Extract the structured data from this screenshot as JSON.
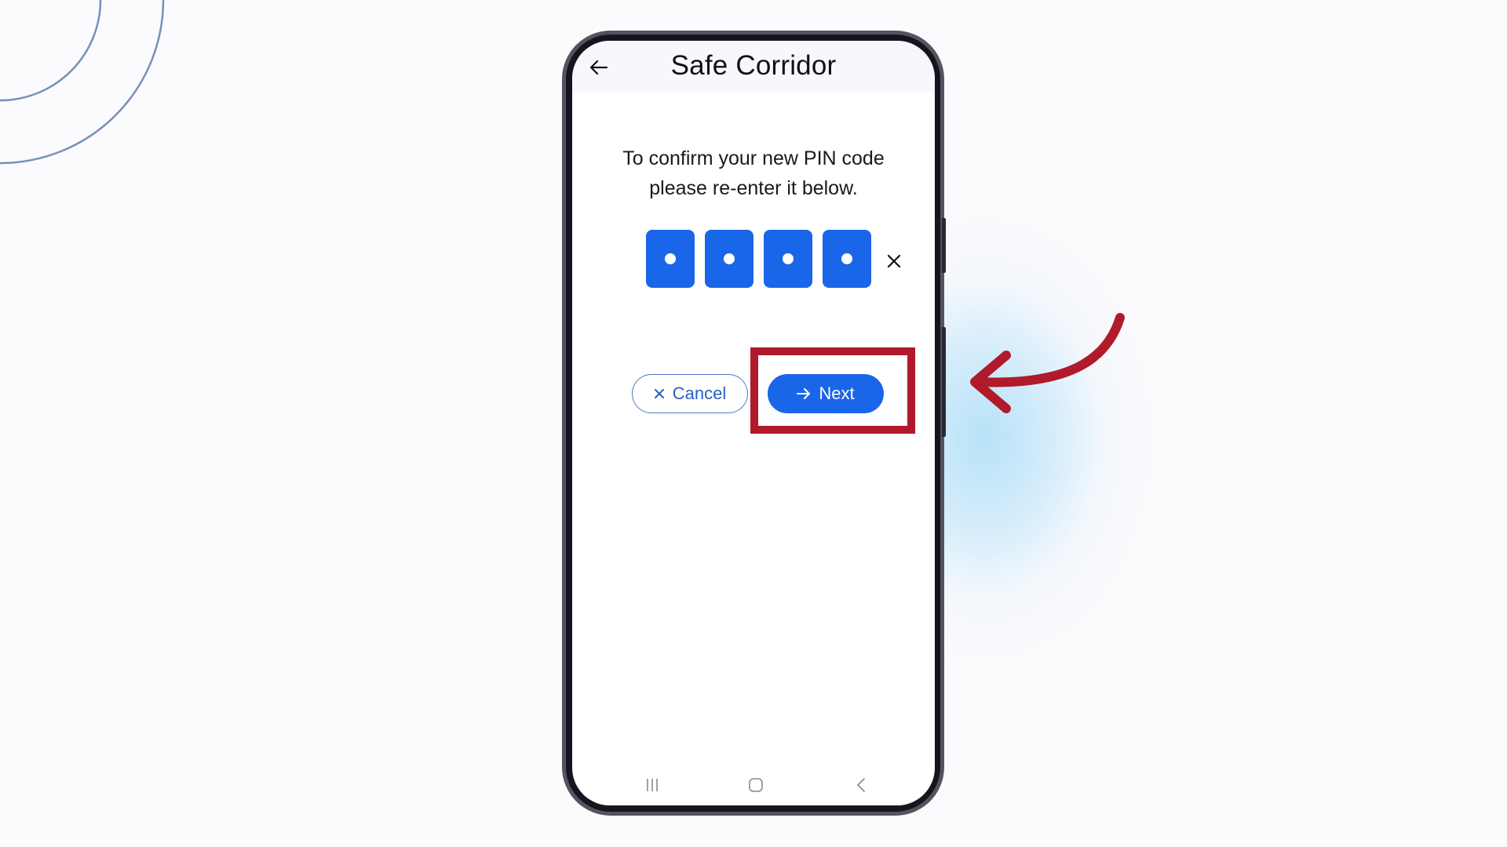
{
  "app": {
    "title": "Safe Corridor"
  },
  "screen": {
    "instructions_line1": "To confirm your new PIN code",
    "instructions_line2": "please re-enter it below.",
    "pin": {
      "length": 4,
      "entered_digits": 4,
      "masked": true
    },
    "buttons": {
      "cancel_label": "Cancel",
      "next_label": "Next"
    }
  },
  "icons": {
    "back": "arrow-left",
    "clear_pin": "close-x",
    "cancel": "close-x",
    "next": "arrow-right",
    "nav_recents": "three-bars",
    "nav_home": "rounded-square",
    "nav_back": "chevron-left"
  },
  "colors": {
    "primary": "#1a66e8",
    "cancel_text": "#2a5fc0",
    "highlight": "#b01a2b",
    "background": "#fbfafd",
    "glow": "#cdeaf8",
    "deco_circles": "#7890b8"
  },
  "annotation": {
    "highlight_target": "Next",
    "pointer": "curved-arrow-left"
  }
}
